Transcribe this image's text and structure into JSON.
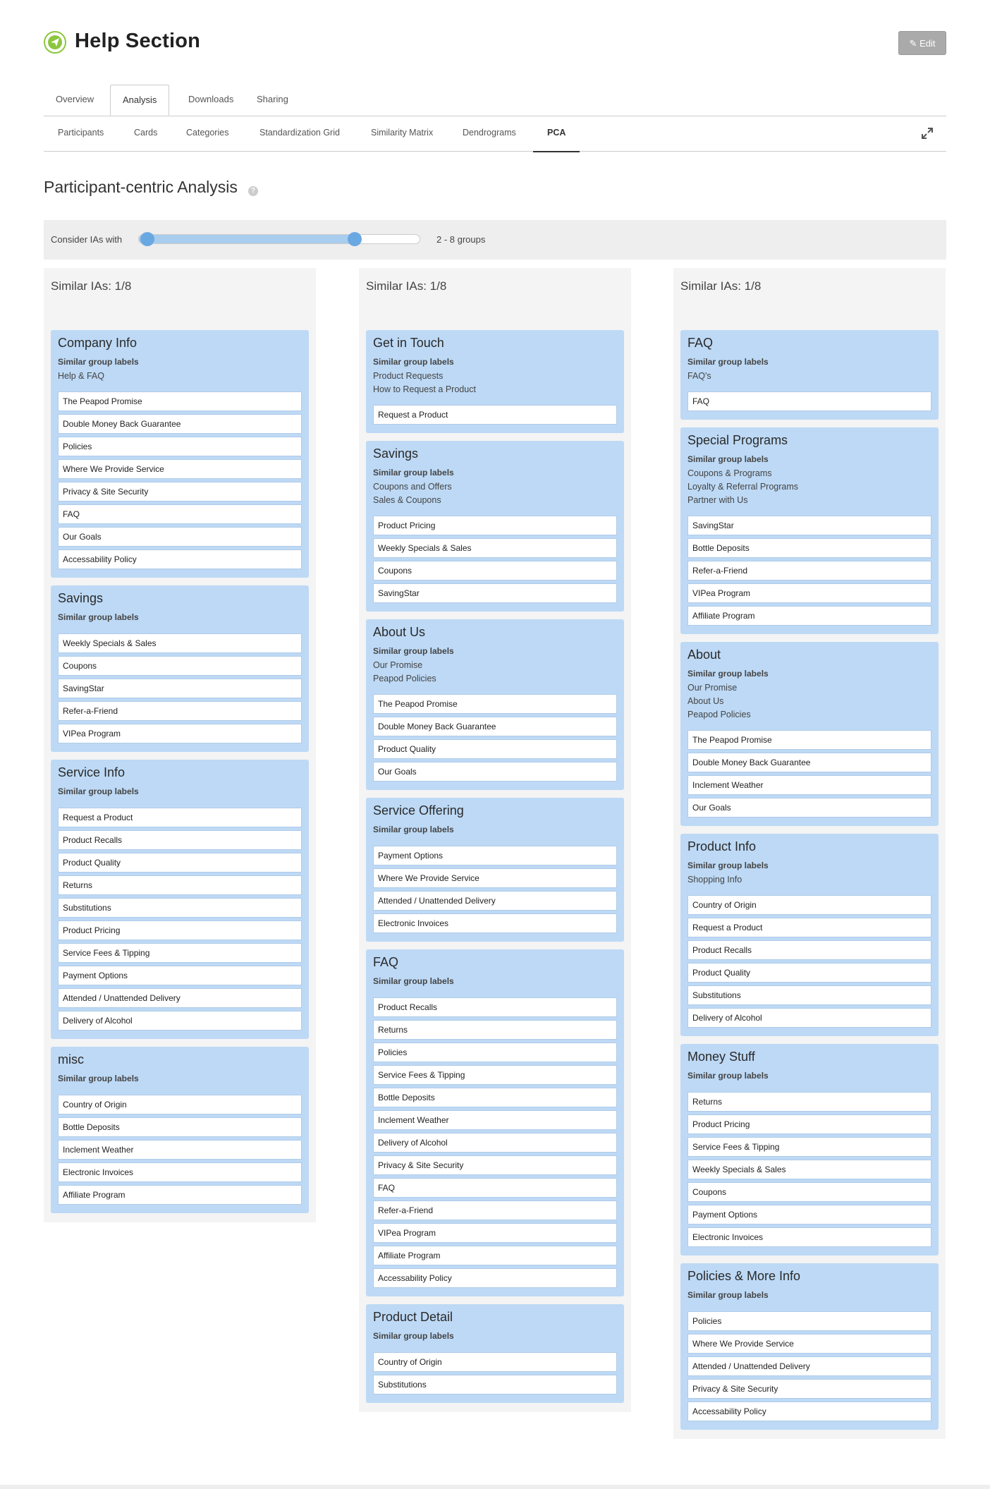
{
  "header": {
    "title": "Help Section",
    "edit_label": "Edit"
  },
  "tabs": [
    {
      "label": "Overview"
    },
    {
      "label": "Analysis",
      "active": true
    },
    {
      "label": "Downloads"
    },
    {
      "label": "Sharing"
    }
  ],
  "subtabs": [
    {
      "label": "Participants"
    },
    {
      "label": "Cards"
    },
    {
      "label": "Categories"
    },
    {
      "label": "Standardization Grid"
    },
    {
      "label": "Similarity Matrix"
    },
    {
      "label": "Dendrograms"
    },
    {
      "label": "PCA",
      "active": true
    }
  ],
  "section": {
    "title": "Participant-centric Analysis",
    "help": "?"
  },
  "slider": {
    "label": "Consider IAs with",
    "min": 1,
    "max": 10,
    "low": 2,
    "high": 8,
    "value_text": "2 - 8 groups"
  },
  "columns": [
    {
      "title": "Similar IAs: 1/8",
      "groups": [
        {
          "name": "Company Info",
          "sim_label": "Similar group labels",
          "alt_labels": [
            "Help & FAQ"
          ],
          "items": [
            "The Peapod Promise",
            "Double Money Back Guarantee",
            "Policies",
            "Where We Provide Service",
            "Privacy & Site Security",
            "FAQ",
            "Our Goals",
            "Accessability Policy"
          ]
        },
        {
          "name": "Savings",
          "sim_label": "Similar group labels",
          "alt_labels": [],
          "items": [
            "Weekly Specials & Sales",
            "Coupons",
            "SavingStar",
            "Refer-a-Friend",
            "VIPea Program"
          ]
        },
        {
          "name": "Service Info",
          "sim_label": "Similar group labels",
          "alt_labels": [],
          "items": [
            "Request a Product",
            "Product Recalls",
            "Product Quality",
            "Returns",
            "Substitutions",
            "Product Pricing",
            "Service Fees & Tipping",
            "Payment Options",
            "Attended / Unattended Delivery",
            "Delivery of Alcohol"
          ]
        },
        {
          "name": "misc",
          "sim_label": "Similar group labels",
          "alt_labels": [],
          "items": [
            "Country of Origin",
            "Bottle Deposits",
            "Inclement Weather",
            "Electronic Invoices",
            "Affiliate Program"
          ]
        }
      ]
    },
    {
      "title": "Similar IAs: 1/8",
      "groups": [
        {
          "name": "Get in Touch",
          "sim_label": "Similar group labels",
          "alt_labels": [
            "Product Requests",
            "How to Request a Product"
          ],
          "items": [
            "Request a Product"
          ]
        },
        {
          "name": "Savings",
          "sim_label": "Similar group labels",
          "alt_labels": [
            "Coupons and Offers",
            "Sales & Coupons"
          ],
          "items": [
            "Product Pricing",
            "Weekly Specials & Sales",
            "Coupons",
            "SavingStar"
          ]
        },
        {
          "name": "About Us",
          "sim_label": "Similar group labels",
          "alt_labels": [
            "Our Promise",
            "Peapod Policies"
          ],
          "items": [
            "The Peapod Promise",
            "Double Money Back Guarantee",
            "Product Quality",
            "Our Goals"
          ]
        },
        {
          "name": "Service Offering",
          "sim_label": "Similar group labels",
          "alt_labels": [],
          "items": [
            "Payment Options",
            "Where We Provide Service",
            "Attended / Unattended Delivery",
            "Electronic Invoices"
          ]
        },
        {
          "name": "FAQ",
          "sim_label": "Similar group labels",
          "alt_labels": [],
          "items": [
            "Product Recalls",
            "Returns",
            "Policies",
            "Service Fees & Tipping",
            "Bottle Deposits",
            "Inclement Weather",
            "Delivery of Alcohol",
            "Privacy & Site Security",
            "FAQ",
            "Refer-a-Friend",
            "VIPea Program",
            "Affiliate Program",
            "Accessability Policy"
          ]
        },
        {
          "name": "Product Detail",
          "sim_label": "Similar group labels",
          "alt_labels": [],
          "items": [
            "Country of Origin",
            "Substitutions"
          ]
        }
      ]
    },
    {
      "title": "Similar IAs: 1/8",
      "groups": [
        {
          "name": "FAQ",
          "sim_label": "Similar group labels",
          "alt_labels": [
            "FAQ's"
          ],
          "items": [
            "FAQ"
          ]
        },
        {
          "name": "Special Programs",
          "sim_label": "Similar group labels",
          "alt_labels": [
            "Coupons & Programs",
            "Loyalty & Referral Programs",
            "Partner with Us"
          ],
          "items": [
            "SavingStar",
            "Bottle Deposits",
            "Refer-a-Friend",
            "VIPea Program",
            "Affiliate Program"
          ]
        },
        {
          "name": "About",
          "sim_label": "Similar group labels",
          "alt_labels": [
            "Our Promise",
            "About Us",
            "Peapod Policies"
          ],
          "items": [
            "The Peapod Promise",
            "Double Money Back Guarantee",
            "Inclement Weather",
            "Our Goals"
          ]
        },
        {
          "name": "Product Info",
          "sim_label": "Similar group labels",
          "alt_labels": [
            "Shopping Info"
          ],
          "items": [
            "Country of Origin",
            "Request a Product",
            "Product Recalls",
            "Product Quality",
            "Substitutions",
            "Delivery of Alcohol"
          ]
        },
        {
          "name": "Money Stuff",
          "sim_label": "Similar group labels",
          "alt_labels": [],
          "items": [
            "Returns",
            "Product Pricing",
            "Service Fees & Tipping",
            "Weekly Specials & Sales",
            "Coupons",
            "Payment Options",
            "Electronic Invoices"
          ]
        },
        {
          "name": "Policies & More Info",
          "sim_label": "Similar group labels",
          "alt_labels": [],
          "items": [
            "Policies",
            "Where We Provide Service",
            "Attended / Unattended Delivery",
            "Privacy & Site Security",
            "Accessability Policy"
          ]
        }
      ]
    }
  ]
}
